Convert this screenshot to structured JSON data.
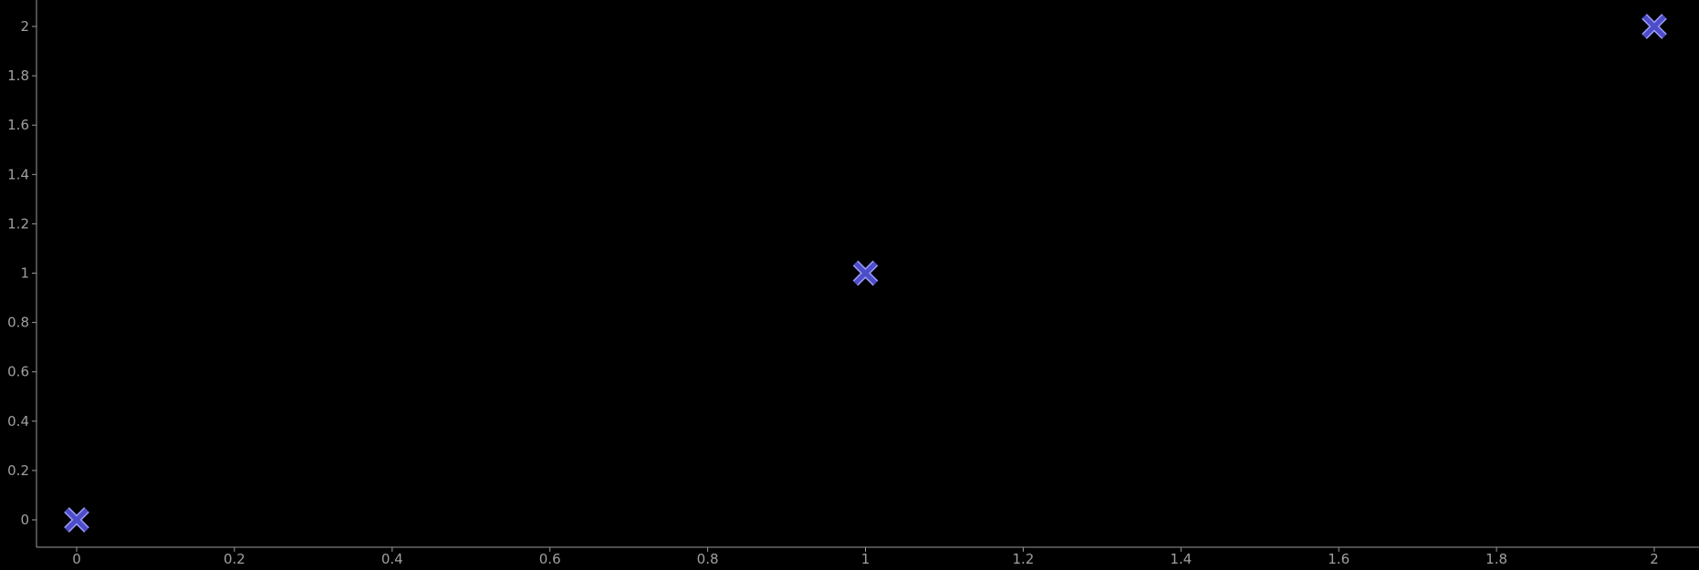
{
  "chart_data": {
    "type": "scatter",
    "title": "",
    "xlabel": "",
    "ylabel": "",
    "xlim": [
      -0.05,
      2.05
    ],
    "ylim": [
      -0.1,
      2.1
    ],
    "x_ticks": [
      0,
      0.2,
      0.4,
      0.6,
      0.8,
      1,
      1.2,
      1.4,
      1.6,
      1.8,
      2
    ],
    "x_tick_labels": [
      "0",
      "0.2",
      "0.4",
      "0.6",
      "0.8",
      "1",
      "1.2",
      "1.4",
      "1.6",
      "1.8",
      "2"
    ],
    "y_ticks": [
      0,
      0.2,
      0.4,
      0.6,
      0.8,
      1,
      1.2,
      1.4,
      1.6,
      1.8,
      2
    ],
    "y_tick_labels": [
      "0",
      "0.2",
      "0.4",
      "0.6",
      "0.8",
      "1",
      "1.2",
      "1.4",
      "1.6",
      "1.8",
      "2"
    ],
    "grid": false,
    "series": [
      {
        "marker": "x",
        "points": [
          {
            "x": 0,
            "y": 0
          },
          {
            "x": 1,
            "y": 1
          },
          {
            "x": 2,
            "y": 2
          }
        ]
      }
    ]
  },
  "colors": {
    "background": "#000000",
    "axis": "#9a9a9a",
    "tick_label": "#a0a0a0",
    "marker_fill": "#4d4dc8",
    "marker_edge": "#9b9bff"
  }
}
